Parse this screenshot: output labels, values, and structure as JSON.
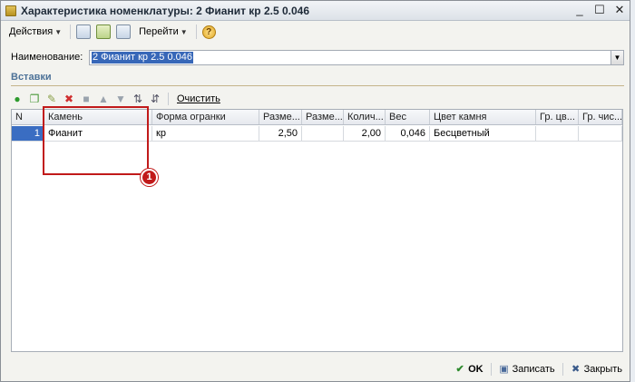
{
  "window": {
    "title": "Характеристика номенклатуры: 2 Фианит кр 2.5 0.046",
    "controls": [
      "_",
      "☐",
      "✕"
    ]
  },
  "toolbar": {
    "actions_label": "Действия",
    "goto_label": "Перейти",
    "help_icon": "?"
  },
  "form": {
    "name_label": "Наименование:",
    "name_value": "2 Фианит кр 2.5 0.046"
  },
  "section": {
    "title": "Вставки"
  },
  "grid_toolbar": {
    "clear_label": "Очистить"
  },
  "table": {
    "columns": [
      "N",
      "Камень",
      "Форма огранки",
      "Разме...",
      "Разме...",
      "Колич...",
      "Вес",
      "Цвет камня",
      "Гр. цв...",
      "Гр. чис..."
    ],
    "rows": [
      [
        "1",
        "Фианит",
        "кр",
        "2,50",
        "",
        "2,00",
        "0,046",
        "Бесцветный",
        "",
        ""
      ]
    ]
  },
  "callout": {
    "number": "1",
    "color": "#c11a1a"
  },
  "footer": {
    "ok_label": "OK",
    "save_label": "Записать",
    "close_label": "Закрыть"
  },
  "colors": {
    "selection": "#3767b8",
    "section_title": "#4d7298"
  }
}
